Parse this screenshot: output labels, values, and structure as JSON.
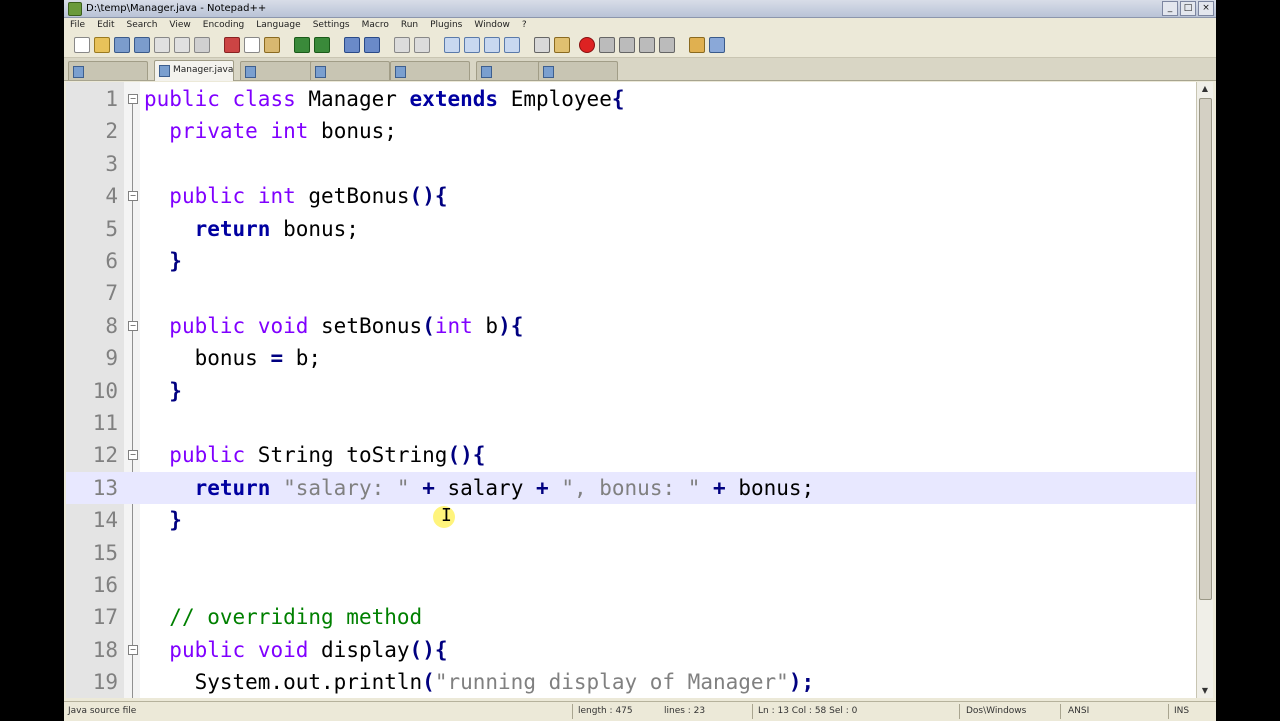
{
  "window": {
    "title": "D:\\temp\\Manager.java - Notepad++"
  },
  "window_controls": {
    "minimize": "_",
    "maximize": "□",
    "close": "×"
  },
  "menu": [
    "File",
    "Edit",
    "Search",
    "View",
    "Encoding",
    "Language",
    "Settings",
    "Macro",
    "Run",
    "Plugins",
    "Window",
    "?"
  ],
  "tabs": [
    {
      "label": "",
      "active": false
    },
    {
      "label": "Manager.java",
      "active": true
    },
    {
      "label": "",
      "active": false
    },
    {
      "label": "",
      "active": false
    },
    {
      "label": "",
      "active": false
    },
    {
      "label": "",
      "active": false
    },
    {
      "label": "",
      "active": false
    }
  ],
  "editor": {
    "current_line": 13,
    "lines": [
      {
        "n": "1",
        "fold": "⊟",
        "tokens": [
          [
            "kw",
            "public"
          ],
          [
            "t",
            " "
          ],
          [
            "kw",
            "class"
          ],
          [
            "t",
            " Manager "
          ],
          [
            "kb",
            "extends"
          ],
          [
            "t",
            " Employee"
          ],
          [
            "op",
            "{"
          ]
        ]
      },
      {
        "n": "2",
        "tokens": [
          [
            "t",
            "  "
          ],
          [
            "kw",
            "private"
          ],
          [
            "t",
            " "
          ],
          [
            "kw",
            "int"
          ],
          [
            "t",
            " bonus;"
          ]
        ]
      },
      {
        "n": "3",
        "tokens": []
      },
      {
        "n": "4",
        "fold": "⊟",
        "tokens": [
          [
            "t",
            "  "
          ],
          [
            "kw",
            "public"
          ],
          [
            "t",
            " "
          ],
          [
            "kw",
            "int"
          ],
          [
            "t",
            " getBonus"
          ],
          [
            "op",
            "(){"
          ]
        ]
      },
      {
        "n": "5",
        "tokens": [
          [
            "t",
            "    "
          ],
          [
            "kb",
            "return"
          ],
          [
            "t",
            " bonus;"
          ]
        ]
      },
      {
        "n": "6",
        "tokens": [
          [
            "t",
            "  "
          ],
          [
            "op",
            "}"
          ]
        ]
      },
      {
        "n": "7",
        "tokens": []
      },
      {
        "n": "8",
        "fold": "⊟",
        "tokens": [
          [
            "t",
            "  "
          ],
          [
            "kw",
            "public"
          ],
          [
            "t",
            " "
          ],
          [
            "kw",
            "void"
          ],
          [
            "t",
            " setBonus"
          ],
          [
            "op",
            "("
          ],
          [
            "kw",
            "int"
          ],
          [
            "t",
            " b"
          ],
          [
            "op",
            "){"
          ]
        ]
      },
      {
        "n": "9",
        "tokens": [
          [
            "t",
            "    bonus "
          ],
          [
            "op",
            "="
          ],
          [
            "t",
            " b;"
          ]
        ]
      },
      {
        "n": "10",
        "tokens": [
          [
            "t",
            "  "
          ],
          [
            "op",
            "}"
          ]
        ]
      },
      {
        "n": "11",
        "tokens": []
      },
      {
        "n": "12",
        "fold": "⊟",
        "tokens": [
          [
            "t",
            "  "
          ],
          [
            "kw",
            "public"
          ],
          [
            "t",
            " String toString"
          ],
          [
            "op",
            "(){"
          ]
        ]
      },
      {
        "n": "13",
        "tokens": [
          [
            "t",
            "    "
          ],
          [
            "kb",
            "return"
          ],
          [
            "t",
            " "
          ],
          [
            "str",
            "\"salary: \""
          ],
          [
            "t",
            " "
          ],
          [
            "op",
            "+"
          ],
          [
            "t",
            " salary "
          ],
          [
            "op",
            "+"
          ],
          [
            "t",
            " "
          ],
          [
            "str",
            "\", bonus: \""
          ],
          [
            "t",
            " "
          ],
          [
            "op",
            "+"
          ],
          [
            "t",
            " bonus;"
          ]
        ]
      },
      {
        "n": "14",
        "tokens": [
          [
            "t",
            "  "
          ],
          [
            "op",
            "}"
          ]
        ]
      },
      {
        "n": "15",
        "tokens": []
      },
      {
        "n": "16",
        "tokens": []
      },
      {
        "n": "17",
        "tokens": [
          [
            "t",
            "  "
          ],
          [
            "cm",
            "// overriding method"
          ]
        ]
      },
      {
        "n": "18",
        "fold": "⊟",
        "tokens": [
          [
            "t",
            "  "
          ],
          [
            "kw",
            "public"
          ],
          [
            "t",
            " "
          ],
          [
            "kw",
            "void"
          ],
          [
            "t",
            " display"
          ],
          [
            "op",
            "(){"
          ]
        ]
      },
      {
        "n": "19",
        "tokens": [
          [
            "t",
            "    System.out.println"
          ],
          [
            "op",
            "("
          ],
          [
            "str",
            "\"running display of Manager\""
          ],
          [
            "op",
            ");"
          ]
        ]
      }
    ]
  },
  "status": {
    "file_type": "Java source file",
    "length": "length : 475",
    "lines": "lines : 23",
    "position": "Ln : 13    Col : 58    Sel : 0",
    "eol": "Dos\\Windows",
    "encoding": "ANSI",
    "mode": "INS"
  },
  "colors": {
    "keyword": "#8000ff",
    "bold_keyword": "#0000a0",
    "string": "#808080",
    "comment": "#008000",
    "operator": "#000080"
  }
}
